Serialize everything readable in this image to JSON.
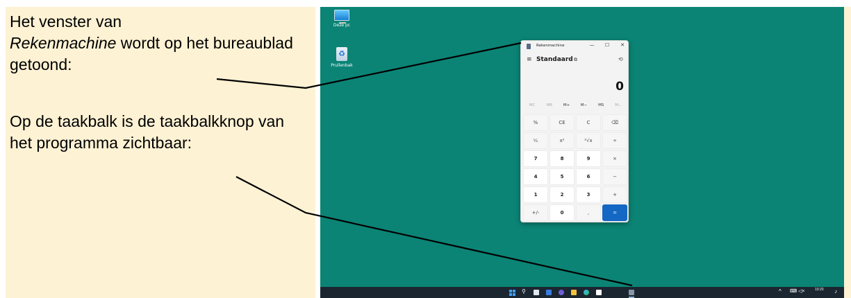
{
  "instructions": {
    "p1_line1": "Het venster van",
    "p1_italic": "Rekenmachine",
    "p1_rest": " wordt op het bureaublad getoond:",
    "p2": "Op de taakbalk is de taakbalkknop van het programma zichtbaar:"
  },
  "desktop": {
    "icons": [
      {
        "label": "Deze pc",
        "icon": "this-pc-icon"
      },
      {
        "label": "Prullenbak",
        "icon": "recycle-bin-icon"
      }
    ],
    "background_color": "#0b8475"
  },
  "calculator": {
    "title": "Rekenmachine",
    "mode": "Standaard",
    "display": "0",
    "window_buttons": {
      "minimize": "—",
      "maximize": "☐",
      "close": "✕"
    },
    "menu_icon": "≡",
    "keep_on_top_icon": "⧉",
    "history_icon": "⟲",
    "memory": [
      {
        "label": "MC",
        "enabled": false
      },
      {
        "label": "MR",
        "enabled": false
      },
      {
        "label": "M+",
        "enabled": true
      },
      {
        "label": "M−",
        "enabled": true
      },
      {
        "label": "MS",
        "enabled": true
      },
      {
        "label": "M⌄",
        "enabled": false
      }
    ],
    "keys": [
      "%",
      "CE",
      "C",
      "⌫",
      "¹⁄ₓ",
      "x²",
      "²√x",
      "÷",
      "7",
      "8",
      "9",
      "×",
      "4",
      "5",
      "6",
      "−",
      "1",
      "2",
      "3",
      "+",
      "+/-",
      "0",
      ",",
      "="
    ],
    "accent_color": "#1467c2"
  },
  "taskbar": {
    "search_icon": "⚲",
    "tray_chevron": "^",
    "tray_icons": "⌨ ◁×",
    "clock_time": "10:20",
    "notification_icon": "♪"
  }
}
